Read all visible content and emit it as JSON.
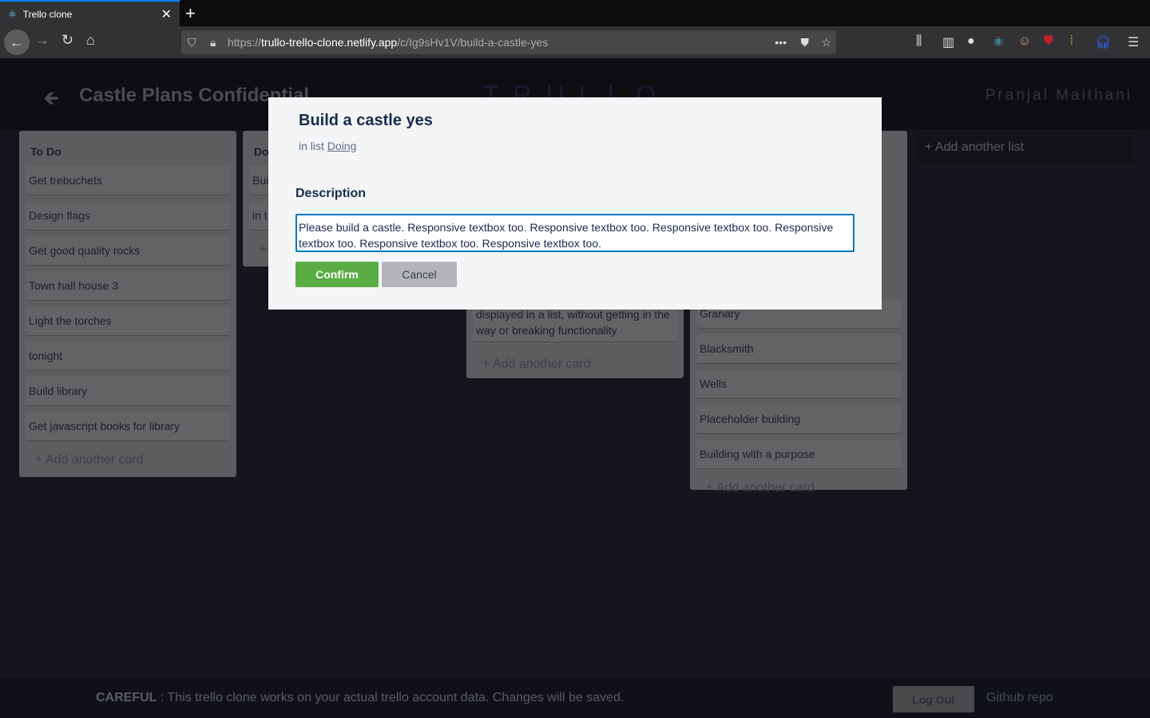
{
  "browser": {
    "tab_title": "Trello clone",
    "url_prefix": "https://",
    "url_host": "trullo-trello-clone.netlify.app",
    "url_path": "/c/Ig9sHv1V/build-a-castle-yes"
  },
  "header": {
    "board_title": "Castle Plans Confidential",
    "logo": "TRULLO",
    "user": "Pranjal Maithani"
  },
  "lists": [
    {
      "title": "To Do",
      "cards": [
        "Get trebuchets",
        "Design flags",
        "Get good quality rocks",
        "Town hall house 3",
        "Light the torches",
        "tonight",
        "Build library",
        "Get javascript books for library"
      ]
    },
    {
      "title": "Do",
      "cards": [
        "Bui",
        "in t"
      ]
    },
    {
      "title": "",
      "cards": [
        "displayed in a list, without getting in the way or breaking functionality"
      ]
    },
    {
      "title": "",
      "cards": [
        "Granary",
        "Blacksmith",
        "Wells",
        "Placeholder building",
        "Building with a purpose"
      ]
    }
  ],
  "add_card_label": "+ Add another card",
  "add_card_partial": "+",
  "add_list_label": "+ Add another list",
  "modal": {
    "title": "Build a castle yes",
    "in_list_prefix": "in list",
    "list_name": "Doing",
    "description_label": "Description",
    "description": "Please build a castle. Responsive textbox too. Responsive textbox too. Responsive textbox too. Responsive textbox too. Responsive textbox too. Responsive textbox too.",
    "confirm": "Confirm",
    "cancel": "Cancel"
  },
  "footer": {
    "careful": "CAREFUL",
    "message": " : This trello clone works on your actual trello account data. Changes will be saved.",
    "logout": "Log Out",
    "github": "Github repo"
  }
}
